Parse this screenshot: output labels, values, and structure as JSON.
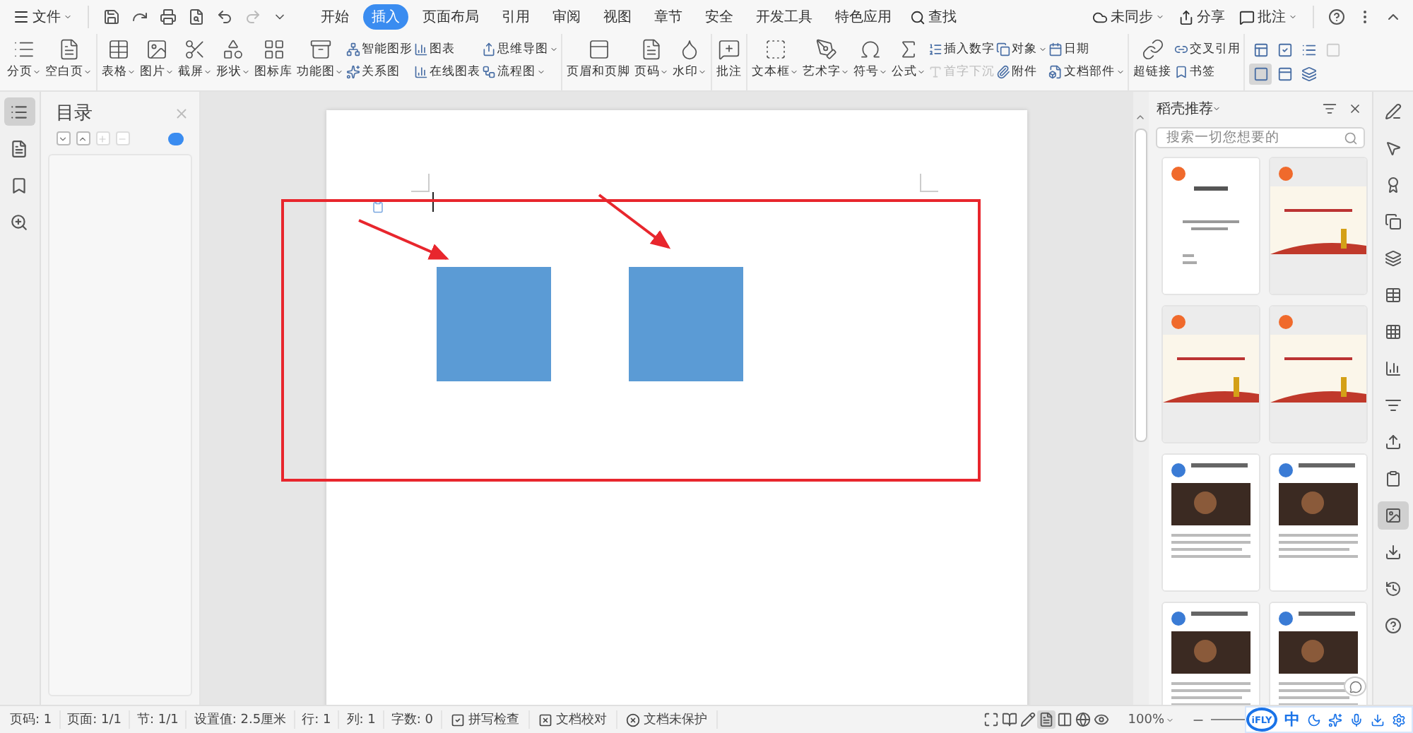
{
  "menu": {
    "file": "文件",
    "tabs": [
      {
        "label": "开始",
        "selected": false
      },
      {
        "label": "插入",
        "selected": true
      },
      {
        "label": "页面布局",
        "selected": false
      },
      {
        "label": "引用",
        "selected": false
      },
      {
        "label": "审阅",
        "selected": false
      },
      {
        "label": "视图",
        "selected": false
      },
      {
        "label": "章节",
        "selected": false
      },
      {
        "label": "安全",
        "selected": false
      },
      {
        "label": "开发工具",
        "selected": false
      },
      {
        "label": "特色应用",
        "selected": false
      }
    ],
    "find": "查找",
    "right": [
      {
        "label": "未同步",
        "caret": true
      },
      {
        "label": "分享",
        "caret": false
      },
      {
        "label": "批注",
        "caret": true
      }
    ]
  },
  "ribbon": [
    {
      "columns": [
        {
          "kind": "big",
          "label": "分页",
          "caret": true
        },
        {
          "kind": "big",
          "label": "空白页",
          "caret": true
        }
      ]
    },
    {
      "columns": [
        {
          "kind": "big",
          "label": "表格",
          "caret": true
        },
        {
          "kind": "big",
          "label": "图片",
          "caret": true
        },
        {
          "kind": "big",
          "label": "截屏",
          "caret": true
        },
        {
          "kind": "big",
          "label": "形状",
          "caret": true
        },
        {
          "kind": "big",
          "label": "图标库",
          "caret": false
        },
        {
          "kind": "big",
          "label": "功能图",
          "caret": true
        },
        {
          "kind": "stack",
          "items": [
            {
              "label": "智能图形",
              "caret": false,
              "disabled": false
            },
            {
              "label": "关系图",
              "caret": false,
              "disabled": false
            }
          ]
        },
        {
          "kind": "stack",
          "items": [
            {
              "label": "图表",
              "caret": false,
              "disabled": false
            },
            {
              "label": "在线图表",
              "caret": false,
              "disabled": false
            }
          ]
        },
        {
          "kind": "stack",
          "items": [
            {
              "label": "思维导图",
              "caret": true,
              "disabled": false
            },
            {
              "label": "流程图",
              "caret": true,
              "disabled": false
            }
          ]
        }
      ]
    },
    {
      "columns": [
        {
          "kind": "big",
          "label": "页眉和页脚",
          "caret": false
        },
        {
          "kind": "big",
          "label": "页码",
          "caret": true
        },
        {
          "kind": "big",
          "label": "水印",
          "caret": true
        }
      ]
    },
    {
      "columns": [
        {
          "kind": "big",
          "label": "批注",
          "caret": false
        }
      ]
    },
    {
      "columns": [
        {
          "kind": "big",
          "label": "文本框",
          "caret": true
        },
        {
          "kind": "big",
          "label": "艺术字",
          "caret": true
        },
        {
          "kind": "big",
          "label": "符号",
          "caret": true
        },
        {
          "kind": "big",
          "label": "公式",
          "caret": true
        },
        {
          "kind": "stack",
          "items": [
            {
              "label": "插入数字",
              "caret": false,
              "disabled": false
            },
            {
              "label": "首字下沉",
              "caret": false,
              "disabled": true
            }
          ]
        },
        {
          "kind": "stack",
          "items": [
            {
              "label": "对象",
              "caret": true,
              "disabled": false
            },
            {
              "label": "附件",
              "caret": false,
              "disabled": false
            }
          ]
        },
        {
          "kind": "stack",
          "items": [
            {
              "label": "日期",
              "caret": false,
              "disabled": false
            },
            {
              "label": "文档部件",
              "caret": true,
              "disabled": false
            }
          ]
        }
      ]
    },
    {
      "columns": [
        {
          "kind": "big",
          "label": "超链接",
          "caret": false
        },
        {
          "kind": "stack",
          "items": [
            {
              "label": "交叉引用",
              "caret": false,
              "disabled": false
            },
            {
              "label": "书签",
              "caret": false,
              "disabled": false
            }
          ]
        }
      ]
    }
  ],
  "view_buttons": [
    {
      "selected": false,
      "disabled": false
    },
    {
      "selected": false,
      "disabled": false
    },
    {
      "selected": false,
      "disabled": false
    },
    {
      "selected": false,
      "disabled": true
    },
    {
      "selected": true,
      "disabled": false
    },
    {
      "selected": false,
      "disabled": false
    },
    {
      "selected": false,
      "disabled": false
    }
  ],
  "left_rail": [
    {
      "selected": true
    },
    {
      "selected": false
    },
    {
      "selected": false
    },
    {
      "selected": false
    }
  ],
  "toc": {
    "title": "目录",
    "outline_on": true,
    "buttons": [
      {
        "disabled": false
      },
      {
        "disabled": false
      },
      {
        "disabled": true
      },
      {
        "disabled": true
      }
    ]
  },
  "template_panel": {
    "title": "稻壳推荐",
    "search": {
      "placeholder": "搜索一切您想要的"
    },
    "templates": [
      {
        "kind": "contract"
      },
      {
        "kind": "banner"
      },
      {
        "kind": "banner"
      },
      {
        "kind": "banner"
      },
      {
        "kind": "article"
      },
      {
        "kind": "article"
      },
      {
        "kind": "article"
      },
      {
        "kind": "article"
      }
    ]
  },
  "right_rail": [
    {
      "selected": false
    },
    {
      "selected": false
    },
    {
      "selected": false
    },
    {
      "selected": false
    },
    {
      "selected": false
    },
    {
      "selected": false
    },
    {
      "selected": false
    },
    {
      "selected": false
    },
    {
      "selected": false
    },
    {
      "selected": false
    },
    {
      "selected": false
    },
    {
      "selected": true
    },
    {
      "selected": false
    },
    {
      "selected": false
    },
    {
      "selected": false
    }
  ],
  "status_bar": {
    "items": [
      {
        "kind": "text",
        "label": "页码: 1"
      },
      {
        "kind": "text",
        "label": "页面: 1/1"
      },
      {
        "kind": "text",
        "label": "节: 1/1"
      },
      {
        "kind": "text",
        "label": "设置值: 2.5厘米"
      },
      {
        "kind": "text",
        "label": "行: 1"
      },
      {
        "kind": "text",
        "label": "列: 1"
      },
      {
        "kind": "text",
        "label": "字数: 0"
      },
      {
        "kind": "check",
        "label": "拼写检查"
      },
      {
        "kind": "proof",
        "label": "文档校对"
      },
      {
        "kind": "protect",
        "label": "文档未保护"
      }
    ],
    "views": [
      {
        "selected": false
      },
      {
        "selected": false
      },
      {
        "selected": false
      },
      {
        "selected": true
      },
      {
        "selected": false
      },
      {
        "selected": false
      },
      {
        "selected": false
      }
    ],
    "zoom": "100%"
  },
  "ime": {
    "logo": "iFLY",
    "mode": "中"
  }
}
